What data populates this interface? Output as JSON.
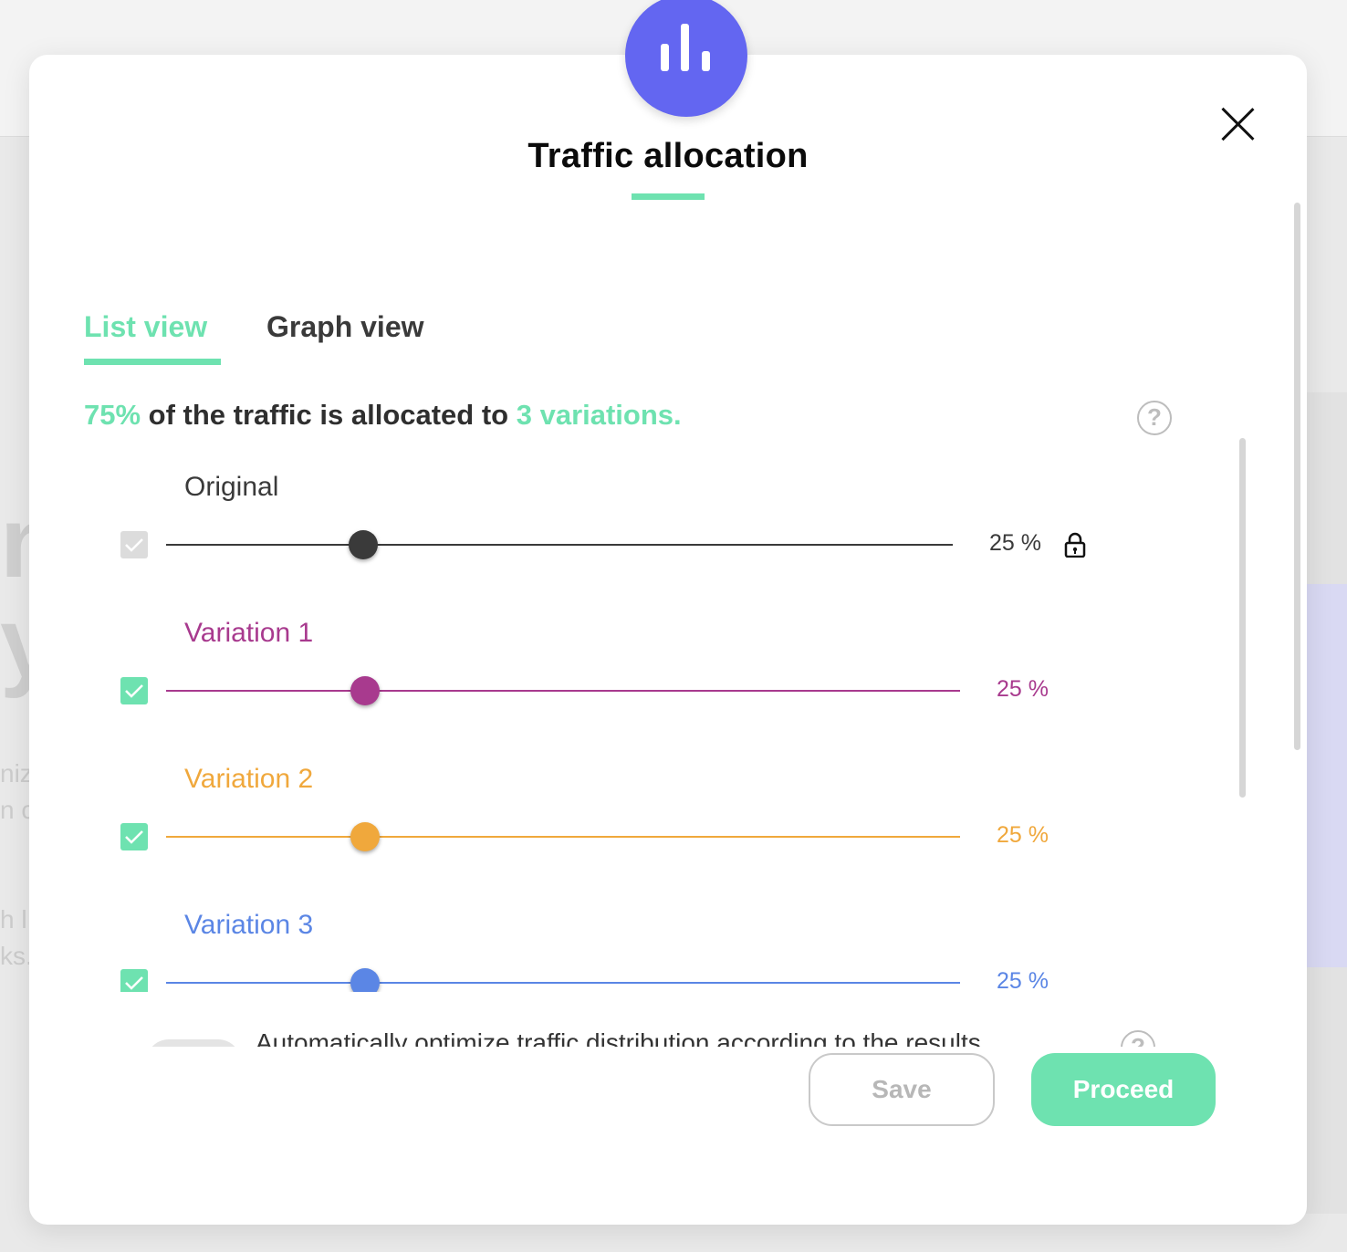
{
  "background": {
    "hero_line_1": "nc",
    "hero_line_2": "y",
    "text_1": "niza",
    "text_2": "n ca",
    "text_3": "h l",
    "text_4": "ks."
  },
  "modal": {
    "title": "Traffic allocation",
    "icon": "bar-chart-icon",
    "close_icon": "close-icon"
  },
  "tabs": [
    {
      "label": "List view",
      "active": true
    },
    {
      "label": "Graph view",
      "active": false
    }
  ],
  "summary": {
    "percent": "75%",
    "middle": " of the traffic is allocated to ",
    "variations": "3 variations."
  },
  "rows": [
    {
      "label": "Original",
      "value": "25 %",
      "fraction": 0.25,
      "checked": true,
      "disabled": true,
      "locked": true,
      "color": "#3a3a3a"
    },
    {
      "label": "Variation 1",
      "value": "25 %",
      "fraction": 0.25,
      "checked": true,
      "disabled": false,
      "locked": false,
      "color": "#a83a8e"
    },
    {
      "label": "Variation 2",
      "value": "25 %",
      "fraction": 0.25,
      "checked": true,
      "disabled": false,
      "locked": false,
      "color": "#f0a83c"
    },
    {
      "label": "Variation 3",
      "value": "25 %",
      "fraction": 0.25,
      "checked": true,
      "disabled": false,
      "locked": false,
      "color": "#5b86e5"
    }
  ],
  "auto_optimize": {
    "label": "Automatically optimize traffic distribution according to the results",
    "enabled": false
  },
  "buttons": {
    "save": "Save",
    "proceed": "Proceed"
  },
  "colors": {
    "accent": "#6ee2b0",
    "badge": "#6366f1",
    "checkbox_checked": "#6ee2b0",
    "checkbox_disabled": "#dcdcdc"
  }
}
